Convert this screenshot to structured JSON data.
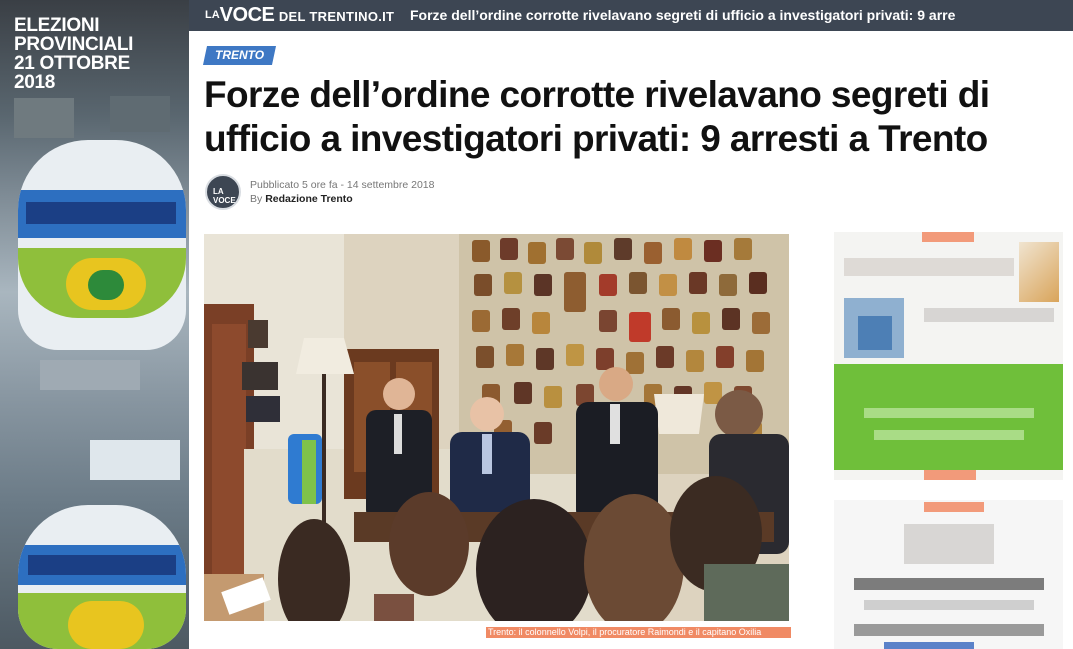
{
  "sidebar_ad": {
    "title_lines": [
      "ELEZIONI",
      "PROVINCIALI",
      "21 OTTOBRE",
      "2018"
    ]
  },
  "header": {
    "brand_la": "LA",
    "brand_voce": "VOCE",
    "brand_domain": "DEL TRENTINO.IT",
    "article_title": "Forze dell’ordine corrotte rivelavano segreti di ufficio a investigatori privati: 9 arre"
  },
  "article": {
    "category": "TRENTO",
    "headline": "Forze dell’ordine corrotte rivelavano segreti di ufficio a investigatori privati: 9 arresti a Trento",
    "avatar_text": "LA VOCE",
    "published_label": "Pubblicato",
    "published_ago": "5 ore fa",
    "separator": "-",
    "published_date": "14 settembre 2018",
    "by_label": "By",
    "author": "Redazione Trento",
    "photo_caption": "Trento: il colonnello Volpi, il procuratore Raimondi e il capitano Oxilia"
  },
  "colors": {
    "header_bg": "#3d4653",
    "badge_bg": "#3e78c4",
    "caption_bg": "#f08a64",
    "right_ad_green": "#6fbf3a"
  }
}
